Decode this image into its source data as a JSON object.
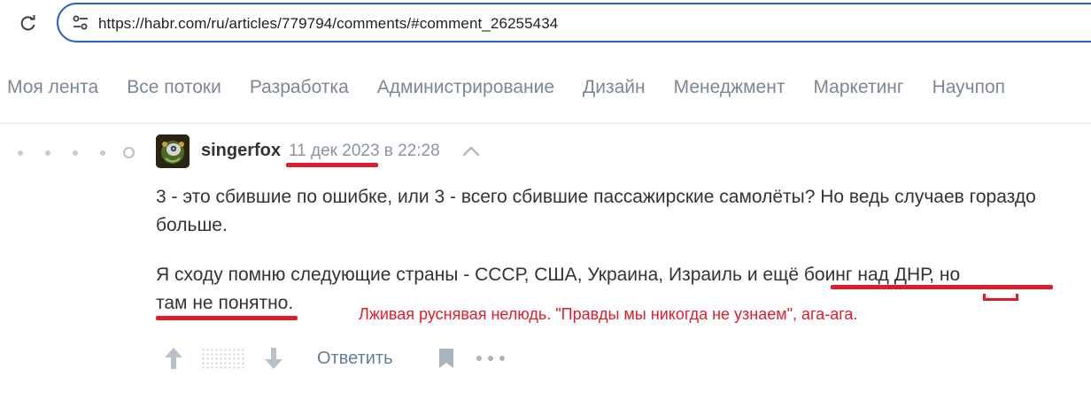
{
  "browser": {
    "url": "https://habr.com/ru/articles/779794/comments/#comment_26255434"
  },
  "nav": {
    "items": [
      "Моя лента",
      "Все потоки",
      "Разработка",
      "Администрирование",
      "Дизайн",
      "Менеджмент",
      "Маркетинг",
      "Научпоп"
    ]
  },
  "comment": {
    "author": "singerfox",
    "date_part": "11 дек 2023",
    "time_part": " в 22:28",
    "paragraph1": "3 - это сбившие по ошибке, или 3 - всего сбившие пассажирские самолёты? Но ведь случаев гораздо больше.",
    "paragraph2_line1_a": "Я сходу помню следующие страны - СССР, США, Украина, Израиль и ",
    "paragraph2_line1_b": "ещё боинг над ДНР, но",
    "paragraph2_line2_a": "там не понятно",
    "paragraph2_line2_b": ".",
    "reply_label": "Ответить"
  },
  "annotation": {
    "text": "Лживая руснявая нелюдь. \"Правды мы никогда не узнаем\", ага-ага.",
    "color": "#e11c2a"
  },
  "icons": {
    "reload": "reload-icon",
    "site_info": "tune-icon",
    "to_parent": "chevron-up-icon",
    "vote_up": "arrow-up-icon",
    "vote_down": "arrow-down-icon",
    "bookmark": "bookmark-icon",
    "more": "more-icon"
  }
}
